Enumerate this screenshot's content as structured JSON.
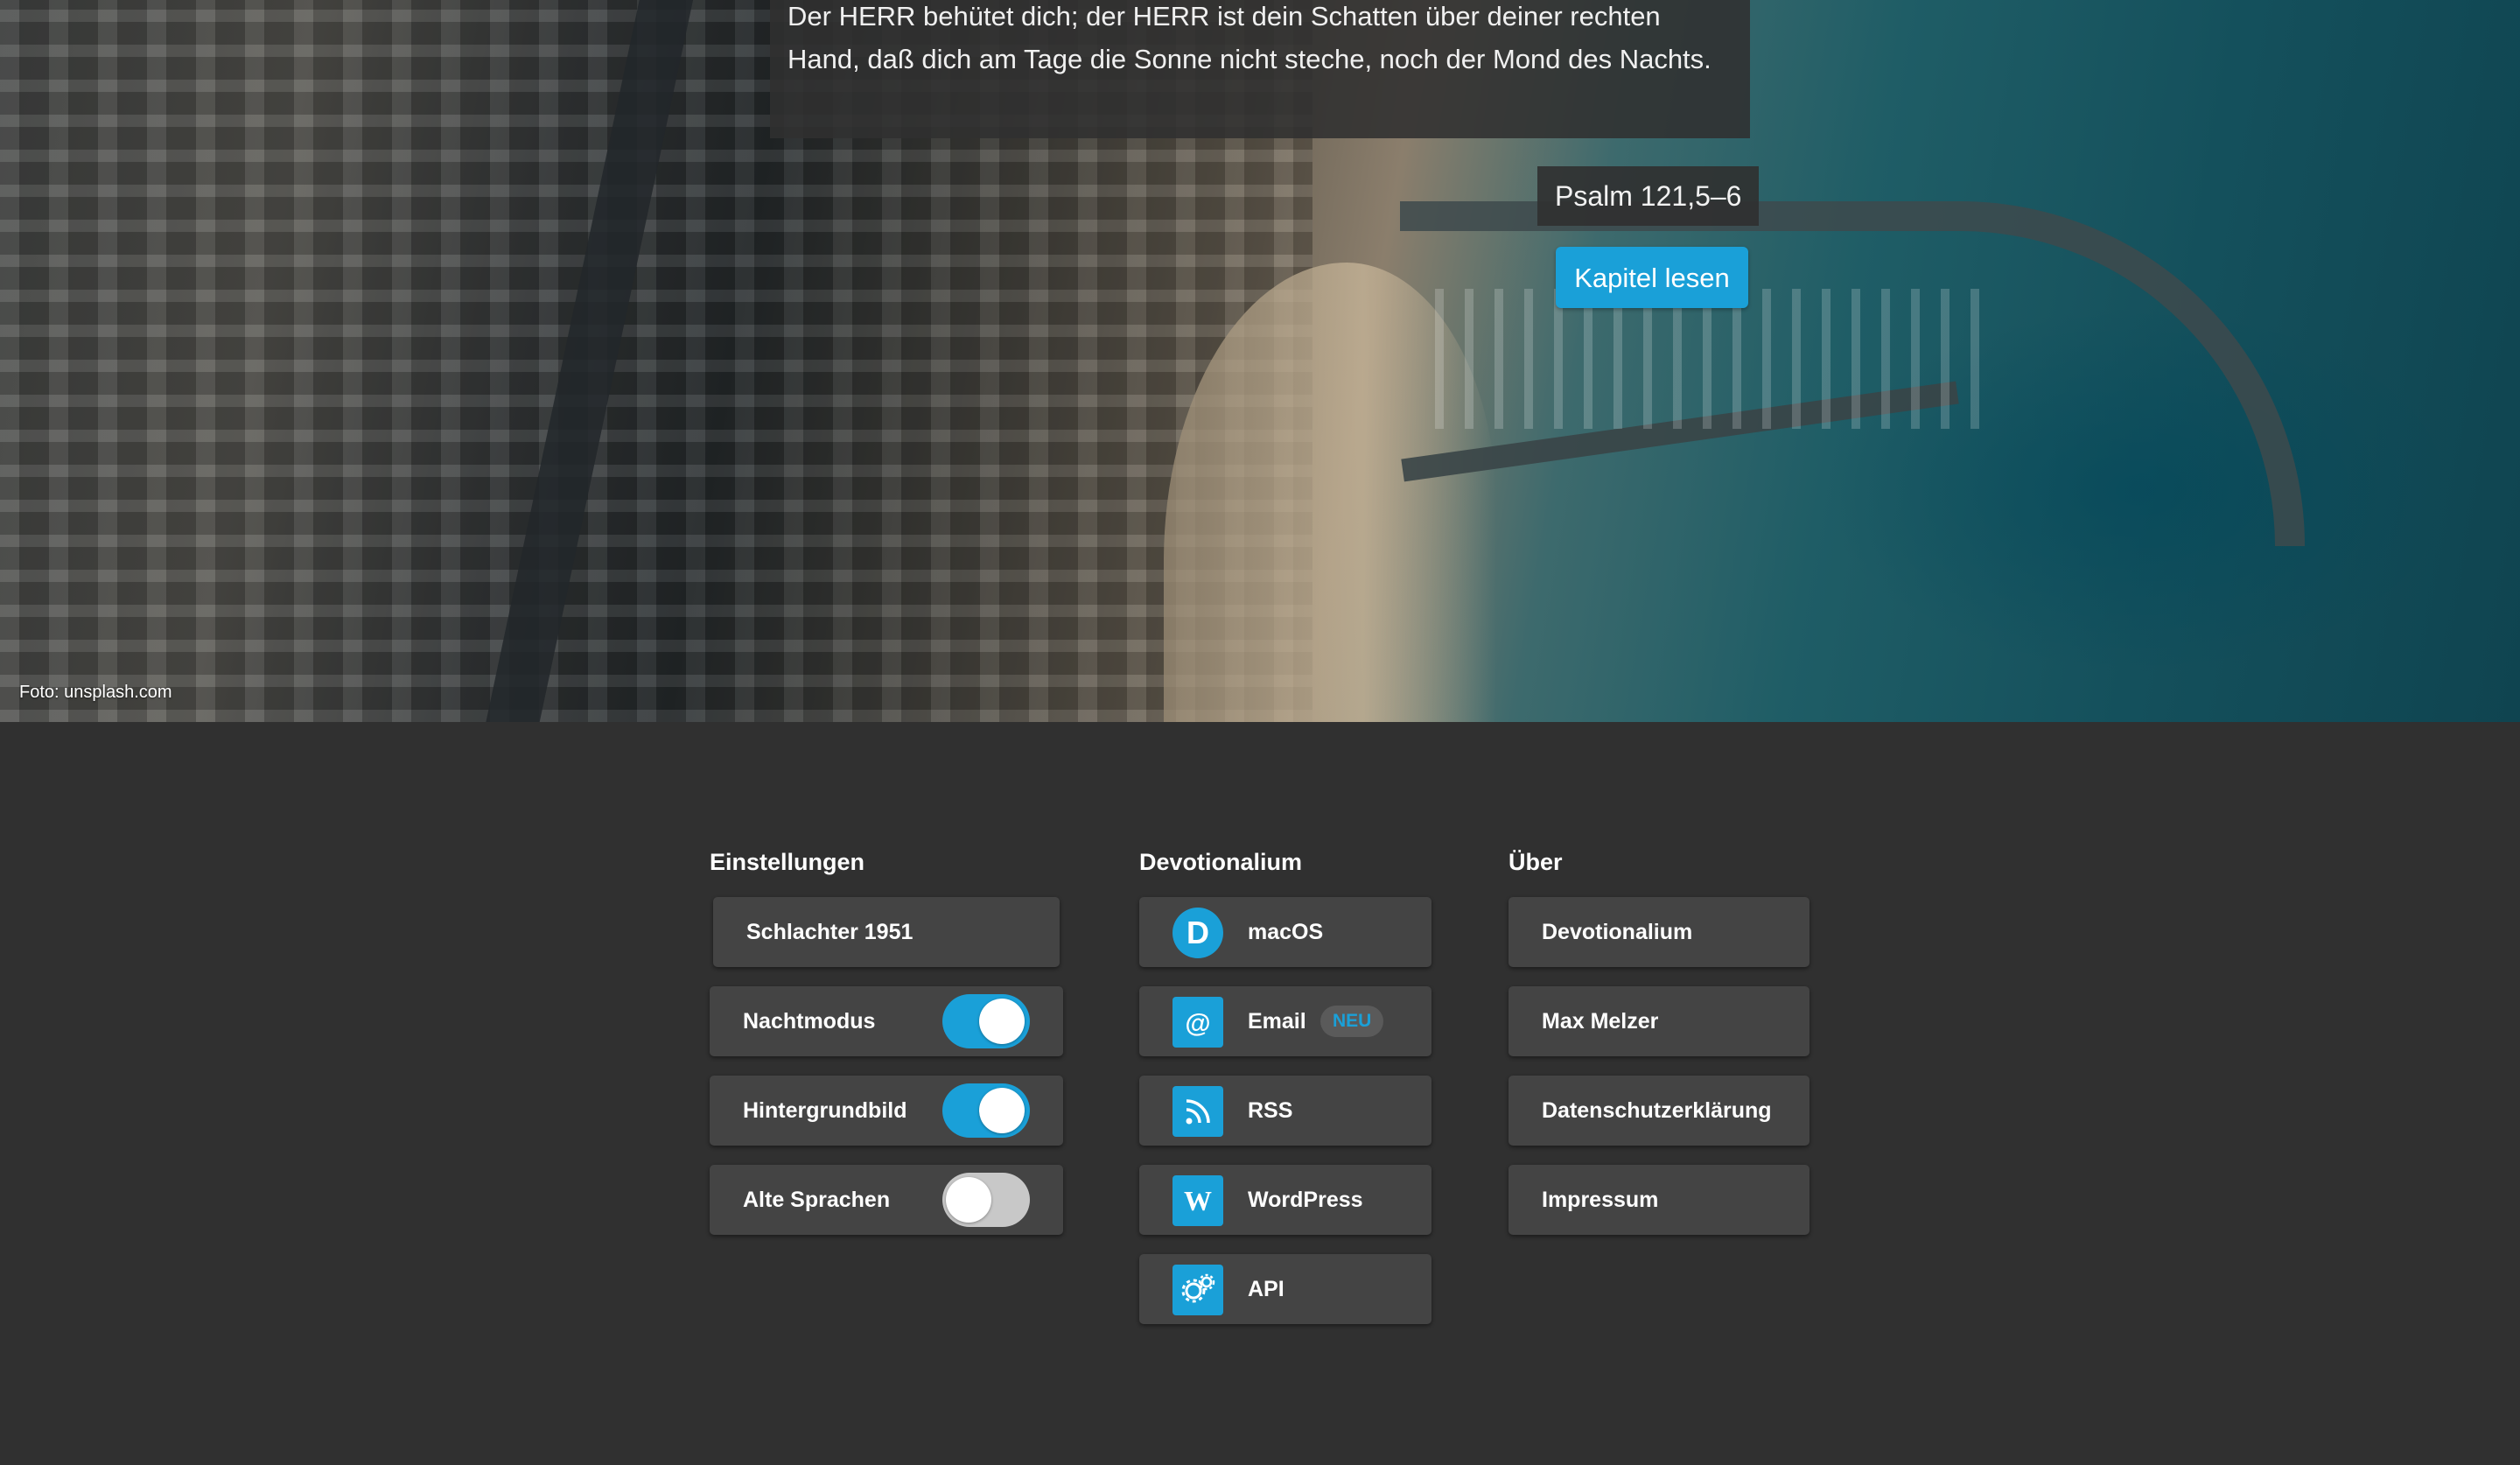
{
  "hero": {
    "verse": "Der HERR behütet dich; der HERR ist dein Schatten über deiner rechten Hand, daß dich am Tage die Sonne nicht steche, noch der Mond des Nachts.",
    "reference": "Psalm 121,5–6",
    "read_button": "Kapitel lesen",
    "photo_credit": "Foto: unsplash.com"
  },
  "settings": {
    "title": "Einstellungen",
    "translation": "Schlachter 1951",
    "toggles": [
      {
        "label": "Nachtmodus",
        "on": true
      },
      {
        "label": "Hintergrundbild",
        "on": true
      },
      {
        "label": "Alte Sprachen",
        "on": false
      }
    ]
  },
  "devotionalium": {
    "title": "Devotionalium",
    "items": [
      {
        "label": "macOS",
        "icon": "d-logo-icon"
      },
      {
        "label": "Email",
        "icon": "at-icon",
        "badge": "NEU"
      },
      {
        "label": "RSS",
        "icon": "rss-icon"
      },
      {
        "label": "WordPress",
        "icon": "wordpress-icon"
      },
      {
        "label": "API",
        "icon": "gears-icon"
      }
    ]
  },
  "about": {
    "title": "Über",
    "items": [
      "Devotionalium",
      "Max Melzer",
      "Datenschutzerklärung",
      "Impressum"
    ]
  },
  "colors": {
    "accent": "#1aa0d8",
    "background": "#303030",
    "card": "#444444"
  }
}
